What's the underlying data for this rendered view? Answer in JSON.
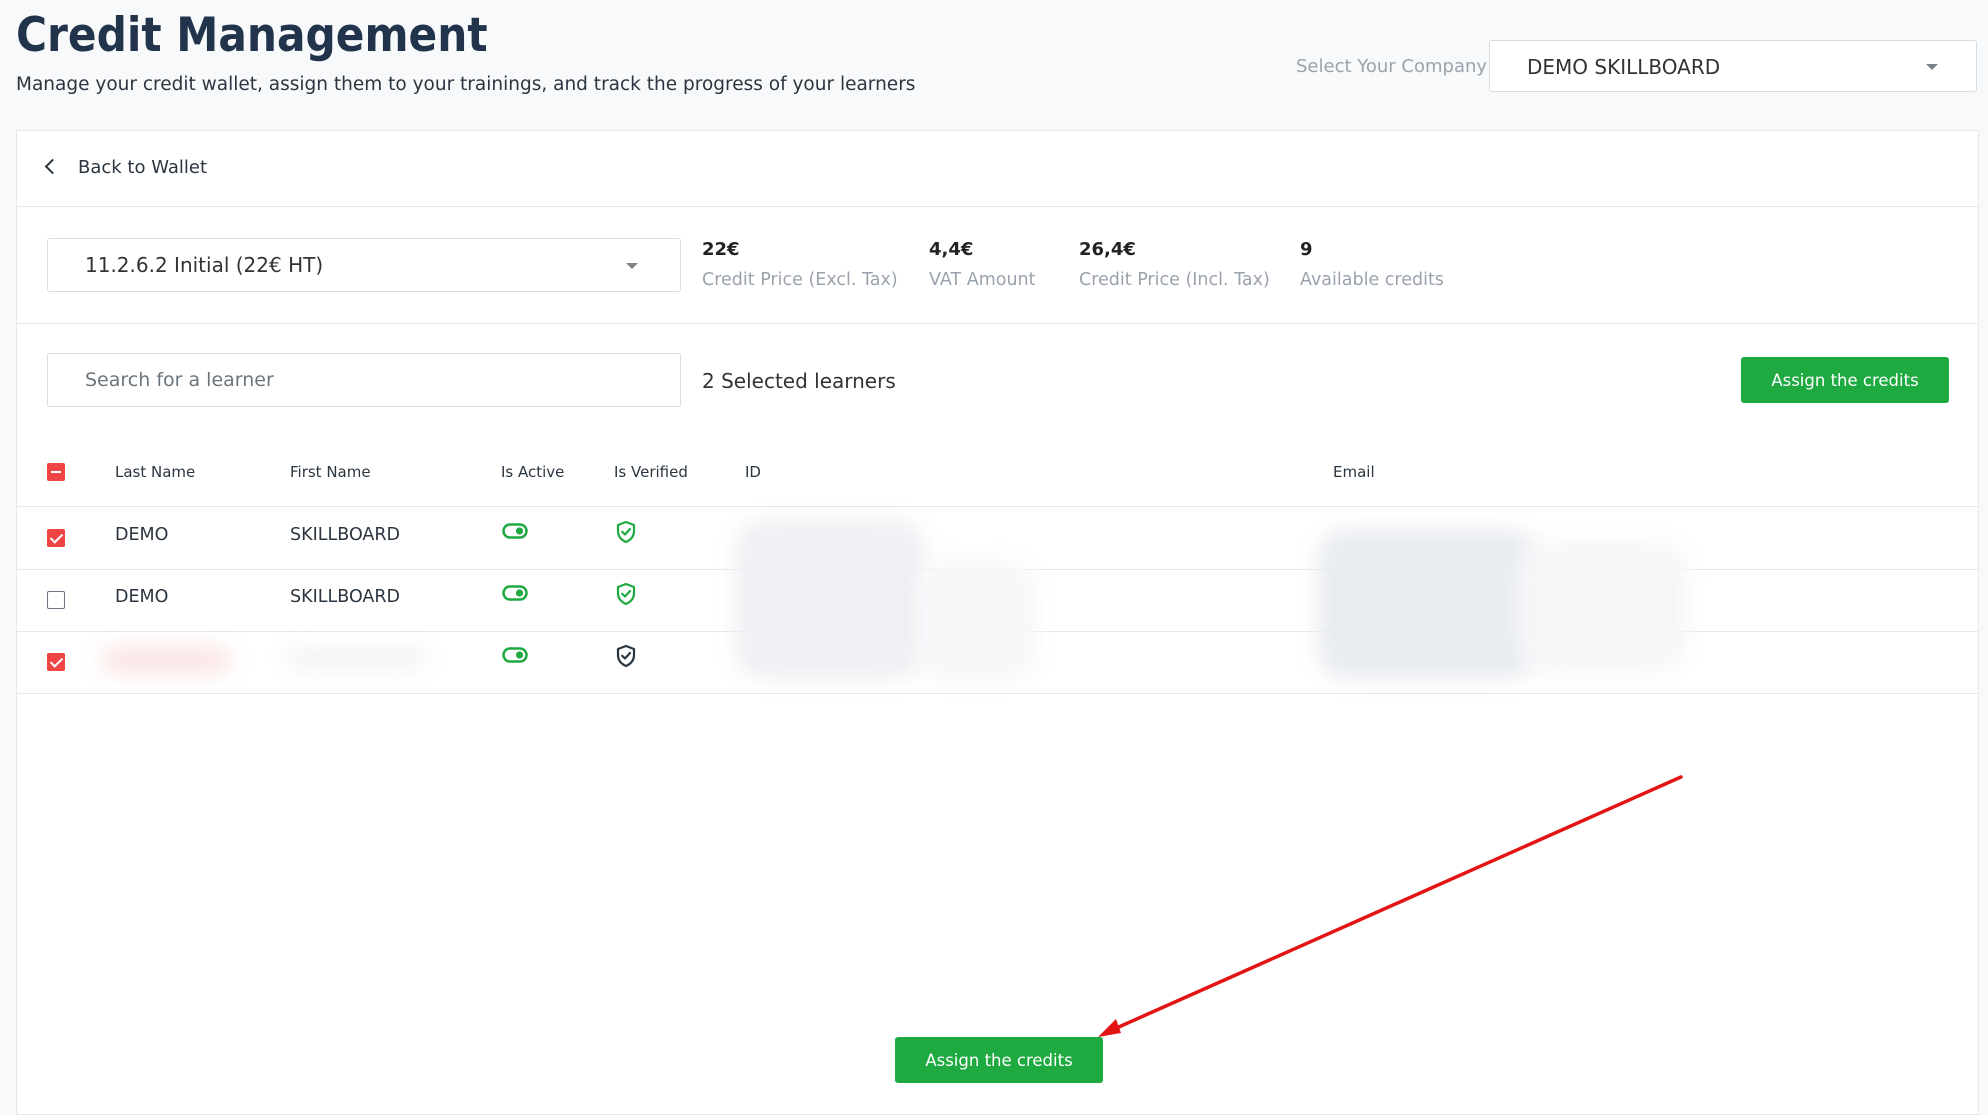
{
  "header": {
    "title": "Credit Management",
    "subtitle": "Manage your credit wallet, assign them to your trainings, and track the progress of your learners",
    "company_label": "Select Your Company",
    "company_value": "DEMO SKILLBOARD"
  },
  "card": {
    "back_label": "Back to Wallet",
    "product_value": "11.2.6.2 Initial (22€ HT)",
    "stats": [
      {
        "value": "22€",
        "label": "Credit Price (Excl. Tax)"
      },
      {
        "value": "4,4€",
        "label": "VAT Amount"
      },
      {
        "value": "26,4€",
        "label": "Credit Price (Incl. Tax)"
      },
      {
        "value": "9",
        "label": "Available credits"
      }
    ],
    "search_placeholder": "Search for a learner",
    "selected_count": "2 Selected learners",
    "assign_label": "Assign the credits"
  },
  "table": {
    "columns": [
      "Last Name",
      "First Name",
      "Is Active",
      "Is Verified",
      "ID",
      "Email"
    ],
    "rows": [
      {
        "last_name": "DEMO",
        "first_name": "SKILLBOARD",
        "checked": true,
        "active": true,
        "verified": true
      },
      {
        "last_name": "DEMO",
        "first_name": "SKILLBOARD",
        "checked": false,
        "active": true,
        "verified": true
      },
      {
        "last_name": "",
        "first_name": "",
        "checked": true,
        "active": true,
        "verified": false
      }
    ]
  },
  "footer": {
    "assign_label": "Assign the credits"
  },
  "colors": {
    "primary_green": "#1ea941",
    "checkbox_red": "#ef4444",
    "title_navy": "#22344c",
    "annotation_arrow": "#e31414"
  },
  "icons": [
    "chevron-down-icon",
    "chevron-left-icon",
    "toggle-on-icon",
    "shield-check-icon",
    "shield-check-dark-icon"
  ]
}
